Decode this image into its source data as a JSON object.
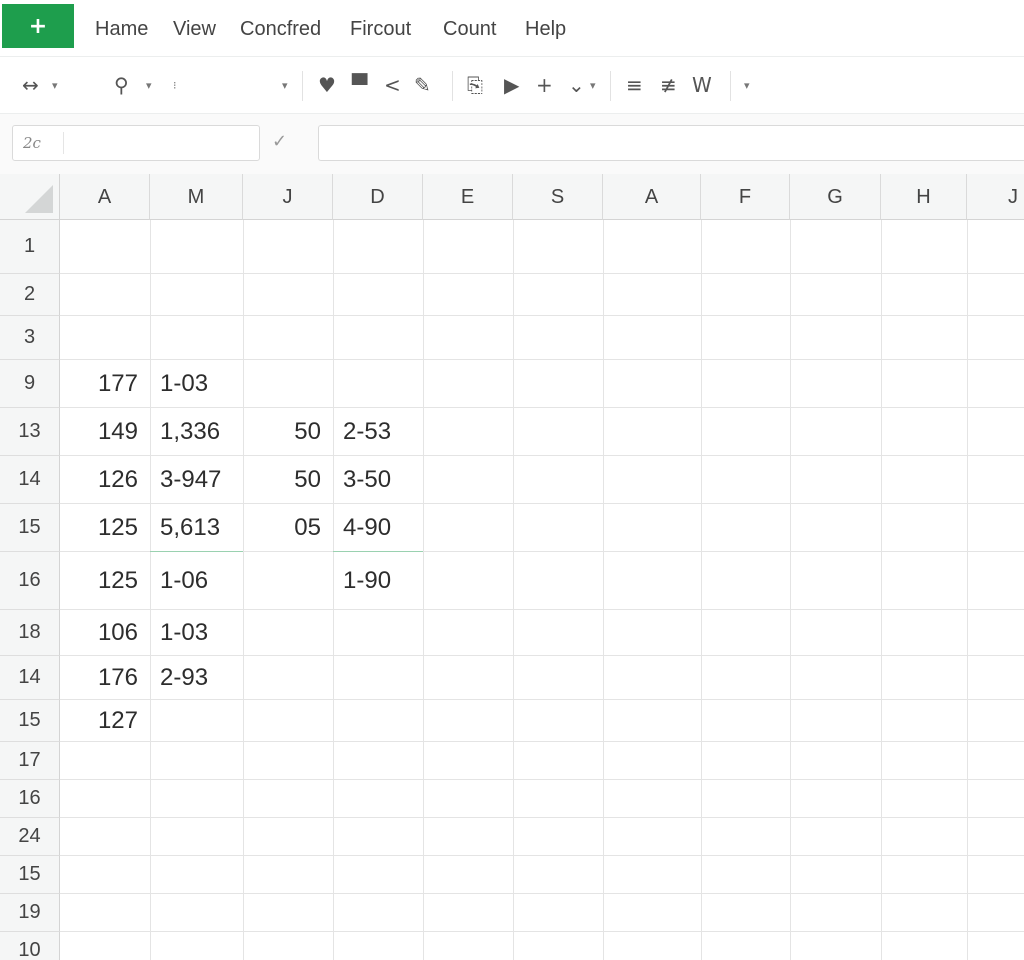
{
  "app": {
    "logo_text": "+",
    "logo_color": "#1e9e4d"
  },
  "menu": [
    "Hame",
    "View",
    "Concfred",
    "Fircout",
    "Count",
    "Help"
  ],
  "toolbar": {
    "undo_icon": "↔",
    "search_icon": "⚲",
    "dropdown_glyph": "▾",
    "dot_glyph": "⁝",
    "heart_icon": "♥",
    "square_icon": "▀",
    "chevron_icon": "<",
    "pencil_icon": "✎",
    "doc_icon": "⎘",
    "play_icon": "▶",
    "plus_icon": "+",
    "double_chevron_icon": "⌄",
    "align_icon": "≡",
    "sort_icon": "≢",
    "w_label": "W"
  },
  "formula_bar": {
    "name_box": "2c",
    "confirm_icon": "✓",
    "formula_value": ""
  },
  "columns": [
    "A",
    "M",
    "J",
    "D",
    "E",
    "S",
    "A",
    "F",
    "G",
    "H",
    "J"
  ],
  "rows": [
    {
      "label": "1",
      "cells": [
        "",
        "",
        "",
        ""
      ]
    },
    {
      "label": "2",
      "cells": [
        "",
        "",
        "",
        ""
      ]
    },
    {
      "label": "3",
      "cells": [
        "",
        "",
        "",
        ""
      ]
    },
    {
      "label": "9",
      "cells": [
        "177",
        "1-03",
        "",
        ""
      ]
    },
    {
      "label": "13",
      "cells": [
        "149",
        "1,336",
        "50",
        "2-53"
      ]
    },
    {
      "label": "14",
      "cells": [
        "126",
        "3-947",
        "50",
        "3-50"
      ]
    },
    {
      "label": "15",
      "cells": [
        "125",
        "5,613",
        "05",
        "4-90"
      ]
    },
    {
      "label": "16",
      "cells": [
        "125",
        "1-06",
        "",
        "1-90"
      ]
    },
    {
      "label": "18",
      "cells": [
        "106",
        "1-03",
        "",
        ""
      ]
    },
    {
      "label": "14",
      "cells": [
        "176",
        "2-93",
        "",
        ""
      ]
    },
    {
      "label": "15",
      "cells": [
        "127",
        "",
        "",
        ""
      ]
    },
    {
      "label": "17",
      "cells": [
        "",
        "",
        "",
        ""
      ]
    },
    {
      "label": "16",
      "cells": [
        "",
        "",
        "",
        ""
      ]
    },
    {
      "label": "24",
      "cells": [
        "",
        "",
        "",
        ""
      ]
    },
    {
      "label": "15",
      "cells": [
        "",
        "",
        "",
        ""
      ]
    },
    {
      "label": "19",
      "cells": [
        "",
        "",
        "",
        ""
      ]
    },
    {
      "label": "10",
      "cells": [
        "",
        "",
        "",
        ""
      ]
    }
  ]
}
